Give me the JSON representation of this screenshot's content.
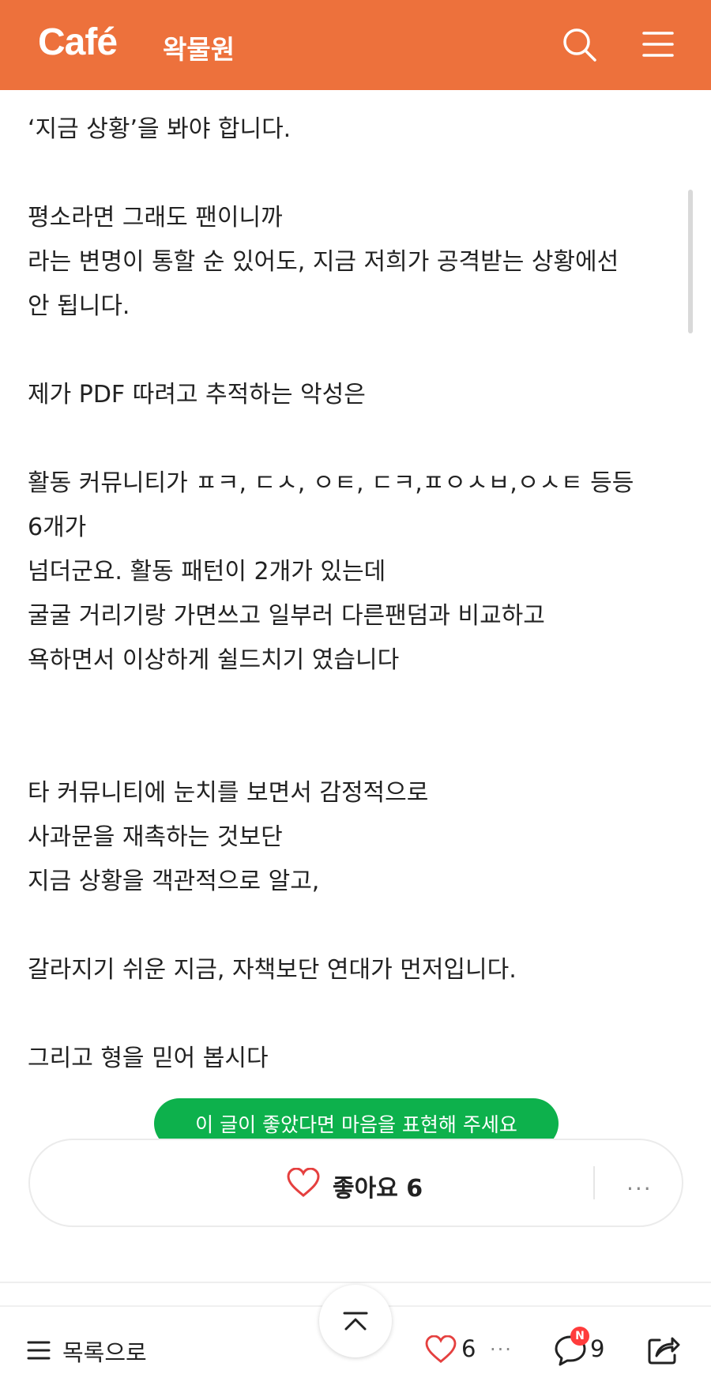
{
  "header": {
    "logo": "Café",
    "cafe_name": "왁물원"
  },
  "article": {
    "lines": [
      "‘지금 상황’을 봐야 합니다.",
      "",
      "평소라면 그래도 팬이니까",
      "라는 변명이 통할 순 있어도, 지금 저희가 공격받는 상황에선",
      "안 됩니다.",
      "",
      "제가 PDF 따려고 추적하는 악성은",
      "",
      "활동 커뮤니티가 ㅍㅋ, ㄷㅅ, ㅇㅌ, ㄷㅋ,ㅍㅇㅅㅂ,ㅇㅅㅌ 등등",
      "6개가",
      "넘더군요. 활동 패턴이 2개가 있는데",
      "굴굴 거리기랑 가면쓰고 일부러 다른팬덤과 비교하고",
      "욕하면서 이상하게 쉴드치기 였습니다",
      "",
      "",
      "타 커뮤니티에 눈치를 보면서 감정적으로",
      "사과문을 재촉하는 것보단",
      "지금 상황을 객관적으로 알고,",
      "",
      "갈라지기 쉬운 지금, 자책보단 연대가 먼저입니다.",
      "",
      "그리고 형을 믿어 봅시다"
    ]
  },
  "tooltip": "이 글이 좋았다면 마음을 표현해 주세요",
  "like_box": {
    "label": "좋아요 6",
    "more": "···"
  },
  "bottom_bar": {
    "list_label": "목록으로",
    "like_count": "6",
    "more": "···",
    "new_badge": "N",
    "comment_count": "9"
  },
  "colors": {
    "brand": "#ed713c",
    "tooltip": "#0db14c",
    "heart": "#e5403f",
    "badge": "#ff3c3c"
  }
}
